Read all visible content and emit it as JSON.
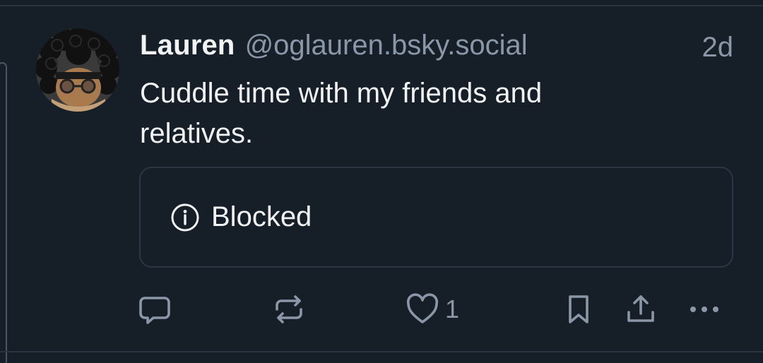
{
  "post": {
    "author": {
      "display_name": "Lauren",
      "handle": "@oglauren.bsky.social"
    },
    "timestamp": "2d",
    "text": "Cuddle time with my friends and relatives.",
    "embed": {
      "icon": "info-circle-icon",
      "label": "Blocked"
    },
    "actions": {
      "reply_icon": "speech-bubble-icon",
      "repost_icon": "repost-arrows-icon",
      "like_icon": "heart-icon",
      "like_count": "1",
      "bookmark_icon": "bookmark-icon",
      "share_icon": "share-upload-icon",
      "more_icon": "ellipsis-icon"
    }
  },
  "colors": {
    "background": "#161e27",
    "primary_text": "#f1f3f5",
    "secondary_text": "#8a97a8",
    "icon": "#8a97a8",
    "border": "#2c3645"
  }
}
